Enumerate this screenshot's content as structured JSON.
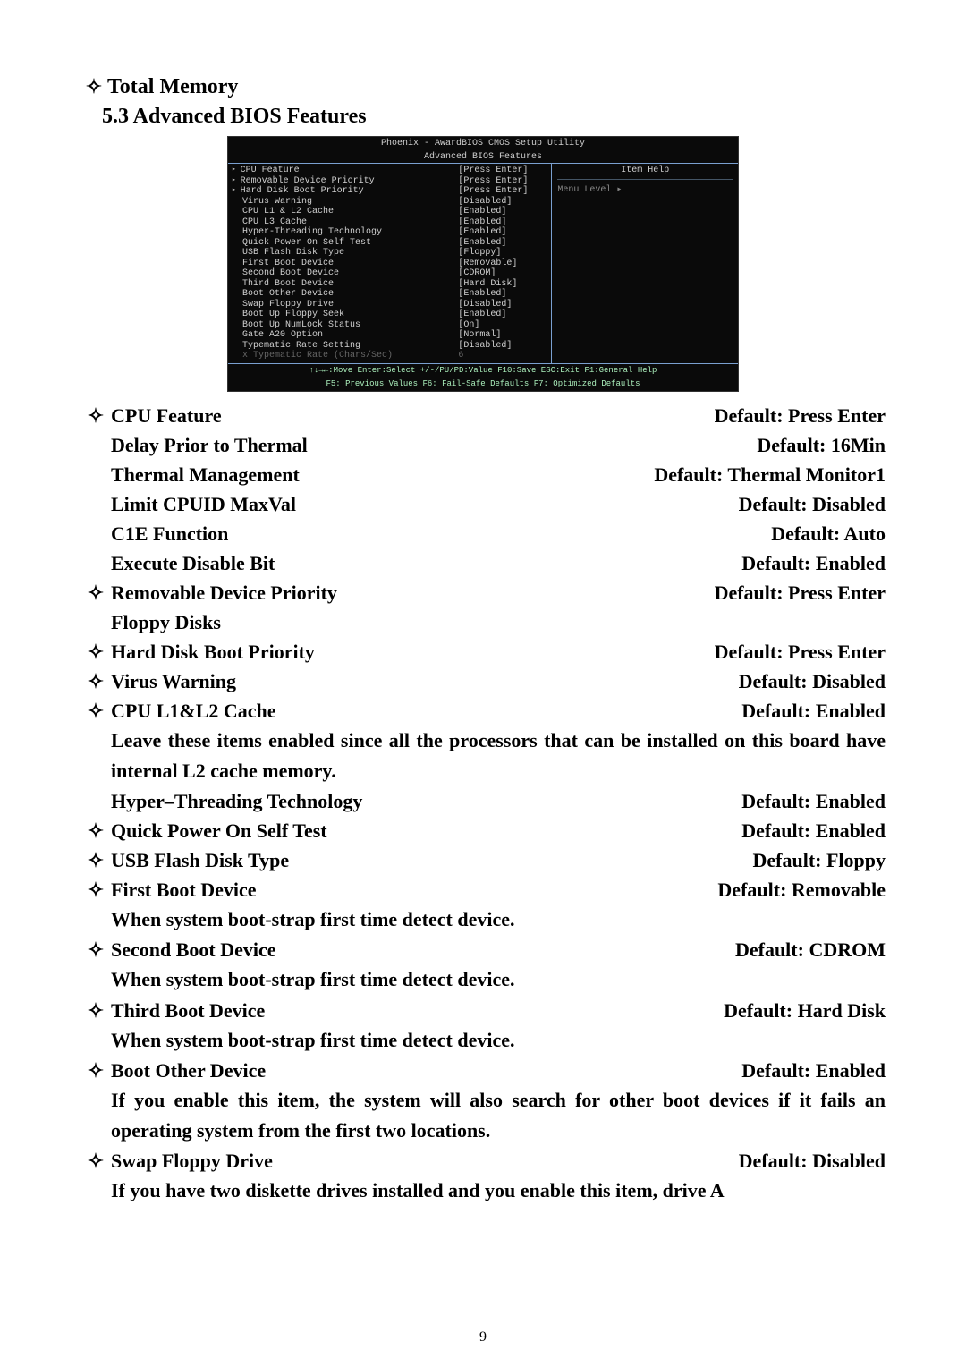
{
  "top": {
    "total_memory": "Total Memory",
    "section_number": "5.3 Advanced BIOS Features"
  },
  "bios": {
    "title1": "Phoenix - AwardBIOS CMOS Setup Utility",
    "title2": "Advanced BIOS Features",
    "help_header": "Item Help",
    "menu_level": "Menu Level   ▸",
    "rows": [
      {
        "arrow": true,
        "l": "CPU Feature",
        "v": "[Press Enter]"
      },
      {
        "arrow": true,
        "l": "Removable Device Priority",
        "v": "[Press Enter]"
      },
      {
        "arrow": true,
        "l": "Hard Disk Boot Priority",
        "v": "[Press Enter]"
      },
      {
        "arrow": false,
        "l": "Virus Warning",
        "v": "[Disabled]"
      },
      {
        "arrow": false,
        "l": "CPU L1 & L2 Cache",
        "v": "[Enabled]"
      },
      {
        "arrow": false,
        "l": "CPU L3 Cache",
        "v": "[Enabled]"
      },
      {
        "arrow": false,
        "l": "Hyper-Threading Technology",
        "v": "[Enabled]"
      },
      {
        "arrow": false,
        "l": "Quick Power On Self Test",
        "v": "[Enabled]"
      },
      {
        "arrow": false,
        "l": "USB Flash Disk Type",
        "v": "[Floppy]"
      },
      {
        "arrow": false,
        "l": "First Boot Device",
        "v": "[Removable]"
      },
      {
        "arrow": false,
        "l": "Second Boot Device",
        "v": "[CDROM]"
      },
      {
        "arrow": false,
        "l": "Third Boot Device",
        "v": "[Hard Disk]"
      },
      {
        "arrow": false,
        "l": "Boot Other Device",
        "v": "[Enabled]"
      },
      {
        "arrow": false,
        "l": "Swap Floppy Drive",
        "v": "[Disabled]"
      },
      {
        "arrow": false,
        "l": "Boot Up Floppy Seek",
        "v": "[Enabled]"
      },
      {
        "arrow": false,
        "l": "Boot Up NumLock Status",
        "v": "[On]"
      },
      {
        "arrow": false,
        "l": "Gate A20 Option",
        "v": "[Normal]"
      },
      {
        "arrow": false,
        "l": "Typematic Rate Setting",
        "v": "[Disabled]"
      },
      {
        "arrow": false,
        "l": "x Typematic Rate (Chars/Sec)",
        "v": "6",
        "dim": true
      }
    ],
    "footer1": "↑↓→←:Move  Enter:Select  +/-/PU/PD:Value  F10:Save   ESC:Exit  F1:General Help",
    "footer2": "F5: Previous Values    F6: Fail-Safe Defaults    F7: Optimized Defaults"
  },
  "items": [
    {
      "mk": "✧",
      "label": "CPU Feature",
      "def": "Default: Press Enter"
    },
    {
      "mk": "",
      "label": "Delay Prior to Thermal",
      "def": "Default: 16Min"
    },
    {
      "mk": "",
      "label": "Thermal Management",
      "def": "Default: Thermal Monitor1"
    },
    {
      "mk": "",
      "label": "Limit CPUID MaxVal",
      "def": "Default: Disabled"
    },
    {
      "mk": "",
      "label": "C1E Function",
      "def": "Default: Auto"
    },
    {
      "mk": "",
      "label": "Execute Disable Bit",
      "def": "Default: Enabled"
    },
    {
      "mk": "✧",
      "label": "Removable Device Priority",
      "def": "Default: Press Enter"
    },
    {
      "mk": "",
      "label": "Floppy Disks",
      "def": ""
    },
    {
      "mk": "✧",
      "label": "Hard Disk Boot Priority",
      "def": "Default: Press Enter"
    },
    {
      "mk": "✧",
      "label": "Virus Warning",
      "def": "Default: Disabled"
    },
    {
      "mk": "✧",
      "label": "CPU L1&L2 Cache",
      "def": "Default: Enabled"
    }
  ],
  "para_l1l2": "Leave these items enabled since all the processors that can be installed on this board have internal L2 cache memory.",
  "items2": [
    {
      "mk": "",
      "label": "Hyper–Threading Technology",
      "def": "Default: Enabled"
    },
    {
      "mk": "✧",
      "label": "Quick Power On Self Test",
      "def": "Default: Enabled"
    },
    {
      "mk": "✧",
      "label": "USB Flash Disk Type",
      "def": "Default: Floppy"
    },
    {
      "mk": "✧",
      "label": "First Boot Device",
      "def": "Default: Removable"
    }
  ],
  "para_first": "When system boot-strap first time detect device.",
  "items3": [
    {
      "mk": "✧",
      "label": "Second Boot Device",
      "def": "Default: CDROM"
    }
  ],
  "para_second": "When system boot-strap first time detect device.",
  "items4": [
    {
      "mk": "✧",
      "label": "Third Boot Device",
      "def": "Default: Hard Disk"
    }
  ],
  "para_third": "When system boot-strap first time detect device.",
  "items5": [
    {
      "mk": "✧",
      "label": "Boot Other Device",
      "def": "Default: Enabled"
    }
  ],
  "para_bootother": "If you enable this item, the system will also search for other boot devices if it fails an operating system from the first two locations.",
  "items6": [
    {
      "mk": "✧",
      "label": "Swap Floppy Drive",
      "def": "Default: Disabled"
    }
  ],
  "para_swap": "If you have two diskette drives installed and you enable this item, drive A",
  "page_number": "9"
}
